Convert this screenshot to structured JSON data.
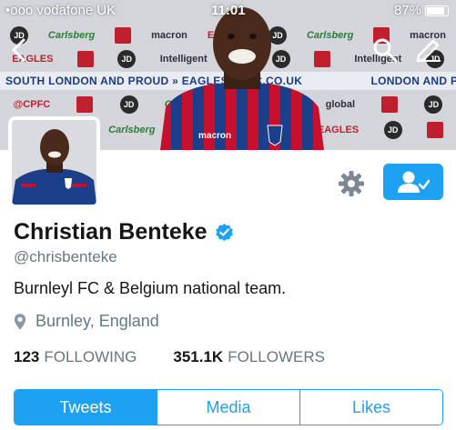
{
  "statusbar": {
    "carrier": "•ooo vodafone UK",
    "time": "11:01",
    "battery_percent": "87%",
    "battery_level": 0.87
  },
  "banner": {
    "slogan_left": "SOUTH LONDON AND PROUD  »  EAGLES.CPFC.CO.UK",
    "slogan_right": "LONDON AND PROUD  »  EAGLES.C",
    "sponsors": [
      "JD",
      "Carlsberg",
      "macron",
      "EAGLES",
      "CPFC.CO.UK",
      "Carlsberg",
      "macron",
      "EAGLES",
      "@CPFC"
    ],
    "shirt_sponsor": "macron",
    "icons": [
      "back-arrow-icon",
      "search-icon",
      "compose-icon"
    ]
  },
  "profile": {
    "display_name": "Christian Benteke",
    "verified": true,
    "handle": "@chrisbenteke",
    "bio": "Burnleyl FC & Belgium national team.",
    "location": "Burnley, England",
    "following_count": "123",
    "following_label": "FOLLOWING",
    "followers_count": "351.1K",
    "followers_label": "FOLLOWERS"
  },
  "tabs": [
    {
      "label": "Tweets",
      "active": true
    },
    {
      "label": "Media",
      "active": false
    },
    {
      "label": "Likes",
      "active": false
    }
  ],
  "colors": {
    "accent": "#1da1f2",
    "text_primary": "#14171a",
    "text_secondary": "#657786",
    "kit_red": "#c8102e",
    "kit_blue": "#1b3f8b"
  }
}
